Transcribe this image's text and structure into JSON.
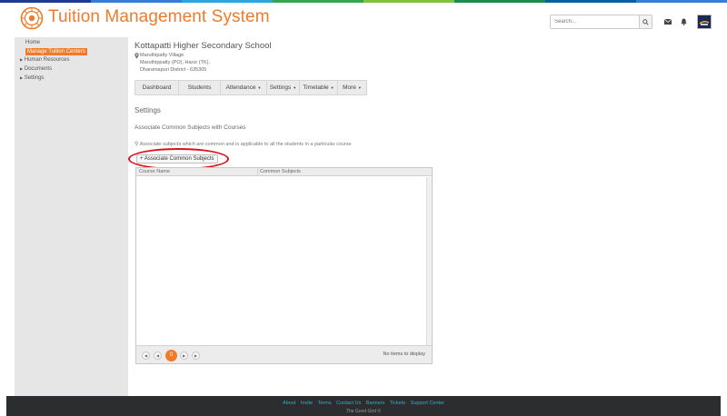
{
  "app": {
    "title": "Tuition Management System",
    "accent_color": "#f07a2a",
    "stripe_colors": [
      "#1a3e8c",
      "#3b7bd1",
      "#29a8d8",
      "#3aa34d",
      "#7dc242",
      "#1f8a4c",
      "#0d5e9e",
      "#3b7bd1"
    ]
  },
  "header": {
    "search_placeholder": "Search...",
    "icons": [
      "search-icon",
      "mail-icon",
      "bell-icon",
      "avatar"
    ]
  },
  "sidebar": {
    "home": "Home",
    "active": "Manage Tuition  Centers",
    "items": [
      {
        "label": "Human Resources",
        "icon": "caret-right-icon"
      },
      {
        "label": "Documents",
        "icon": "caret-right-icon"
      },
      {
        "label": "Settings",
        "icon": "caret-right-icon"
      }
    ]
  },
  "school": {
    "name": "Kottapatti Higher Secondary School",
    "address_line1": "Maruthipatty Village",
    "address_line2": "Maruthippatty (PO), Harur (TK),",
    "address_line3": "Dharamapuri District - 635305"
  },
  "tabs": [
    {
      "label": "Dashboard",
      "dropdown": false
    },
    {
      "label": "Students",
      "dropdown": false
    },
    {
      "label": "Attendance",
      "dropdown": true
    },
    {
      "label": "Settings",
      "dropdown": true
    },
    {
      "label": "Timetable",
      "dropdown": true
    },
    {
      "label": "More",
      "dropdown": true
    }
  ],
  "content": {
    "section_title": "Settings",
    "subtitle": "Associate Common Subjects with Courses",
    "hint": "Associate subjects which are common and is applicable to all the students in a particular course",
    "associate_button": "+ Associate Common Subjects"
  },
  "grid": {
    "columns": [
      "Course Name",
      "Common Subjects"
    ],
    "current_page": "0",
    "empty_text": "No items to display",
    "pager_icons": [
      "first-page-icon",
      "prev-page-icon",
      "next-page-icon",
      "last-page-icon"
    ]
  },
  "footer": {
    "links": [
      "About",
      "Invite",
      "Terms",
      "Contact Us",
      "Banners",
      "Tickets",
      "Support Center"
    ],
    "copyright": "The Good Grid ©"
  }
}
